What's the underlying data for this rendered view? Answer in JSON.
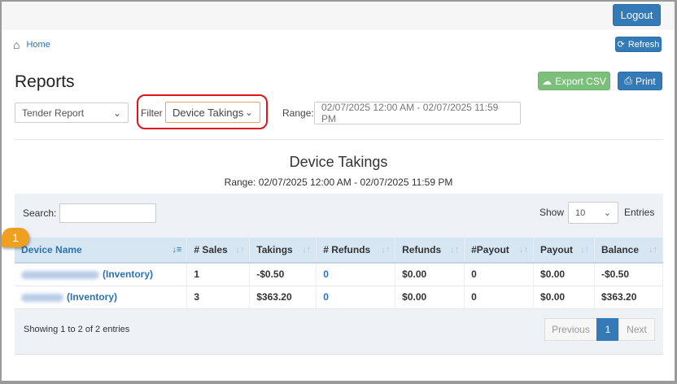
{
  "header": {
    "logout": "Logout"
  },
  "breadcrumb": {
    "home": "Home"
  },
  "toolbar": {
    "refresh": "Refresh",
    "export_csv": "Export CSV",
    "print": "Print"
  },
  "page_title": "Reports",
  "filters": {
    "report_type": "Tender Report",
    "filter_label": "Filter",
    "filter_value": "Device Takings",
    "range_label": "Range:",
    "range_value": "02/07/2025 12:00 AM - 02/07/2025 11:59 PM"
  },
  "report": {
    "title": "Device Takings",
    "subtitle": "Range: 02/07/2025 12:00 AM - 02/07/2025 11:59 PM"
  },
  "table_controls": {
    "search_label": "Search:",
    "search_value": "",
    "show_label": "Show",
    "show_value": "10",
    "entries_label": "Entries"
  },
  "callout": "1",
  "columns": [
    "Device Name",
    "# Sales",
    "Takings",
    "# Refunds",
    "Refunds",
    "#Payout",
    "Payout",
    "Balance"
  ],
  "rows": [
    {
      "device_suffix": "(Inventory)",
      "sales": "1",
      "takings": "-$0.50",
      "refund_count": "0",
      "refunds": "$0.00",
      "payout_count": "0",
      "payout": "$0.00",
      "balance": "-$0.50"
    },
    {
      "device_suffix": "(Inventory)",
      "sales": "3",
      "takings": "$363.20",
      "refund_count": "0",
      "refunds": "$0.00",
      "payout_count": "0",
      "payout": "$0.00",
      "balance": "$363.20"
    }
  ],
  "footer": {
    "info": "Showing 1 to 2 of 2 entries",
    "previous": "Previous",
    "page": "1",
    "next": "Next"
  },
  "colors": {
    "primary": "#337ab7",
    "success": "#7bbf7b",
    "highlight": "#e0141e",
    "callout": "#f0a020"
  }
}
